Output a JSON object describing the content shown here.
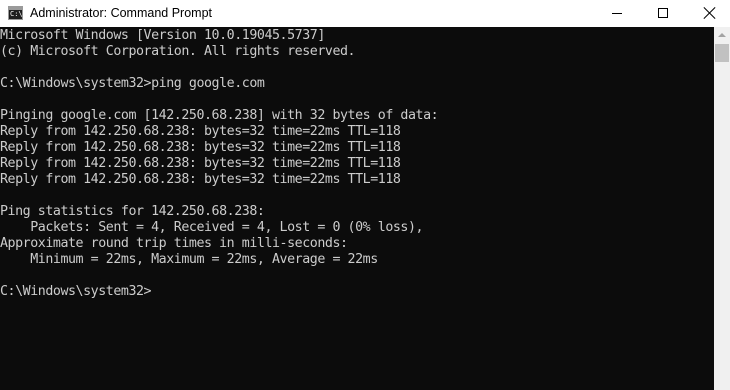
{
  "window": {
    "title": "Administrator: Command Prompt",
    "icon_text": "C:\\"
  },
  "controls": {
    "minimize_icon": "minimize-icon",
    "maximize_icon": "maximize-icon",
    "close_icon": "close-icon"
  },
  "console": {
    "lines": [
      "Microsoft Windows [Version 10.0.19045.5737]",
      "(c) Microsoft Corporation. All rights reserved.",
      "",
      "C:\\Windows\\system32>ping google.com",
      "",
      "Pinging google.com [142.250.68.238] with 32 bytes of data:",
      "Reply from 142.250.68.238: bytes=32 time=22ms TTL=118",
      "Reply from 142.250.68.238: bytes=32 time=22ms TTL=118",
      "Reply from 142.250.68.238: bytes=32 time=22ms TTL=118",
      "Reply from 142.250.68.238: bytes=32 time=22ms TTL=118",
      "",
      "Ping statistics for 142.250.68.238:",
      "    Packets: Sent = 4, Received = 4, Lost = 0 (0% loss),",
      "Approximate round trip times in milli-seconds:",
      "    Minimum = 22ms, Maximum = 22ms, Average = 22ms",
      "",
      "C:\\Windows\\system32>"
    ]
  },
  "colors": {
    "console_background": "#0c0c0c",
    "console_text": "#cccccc",
    "titlebar_background": "#ffffff"
  }
}
